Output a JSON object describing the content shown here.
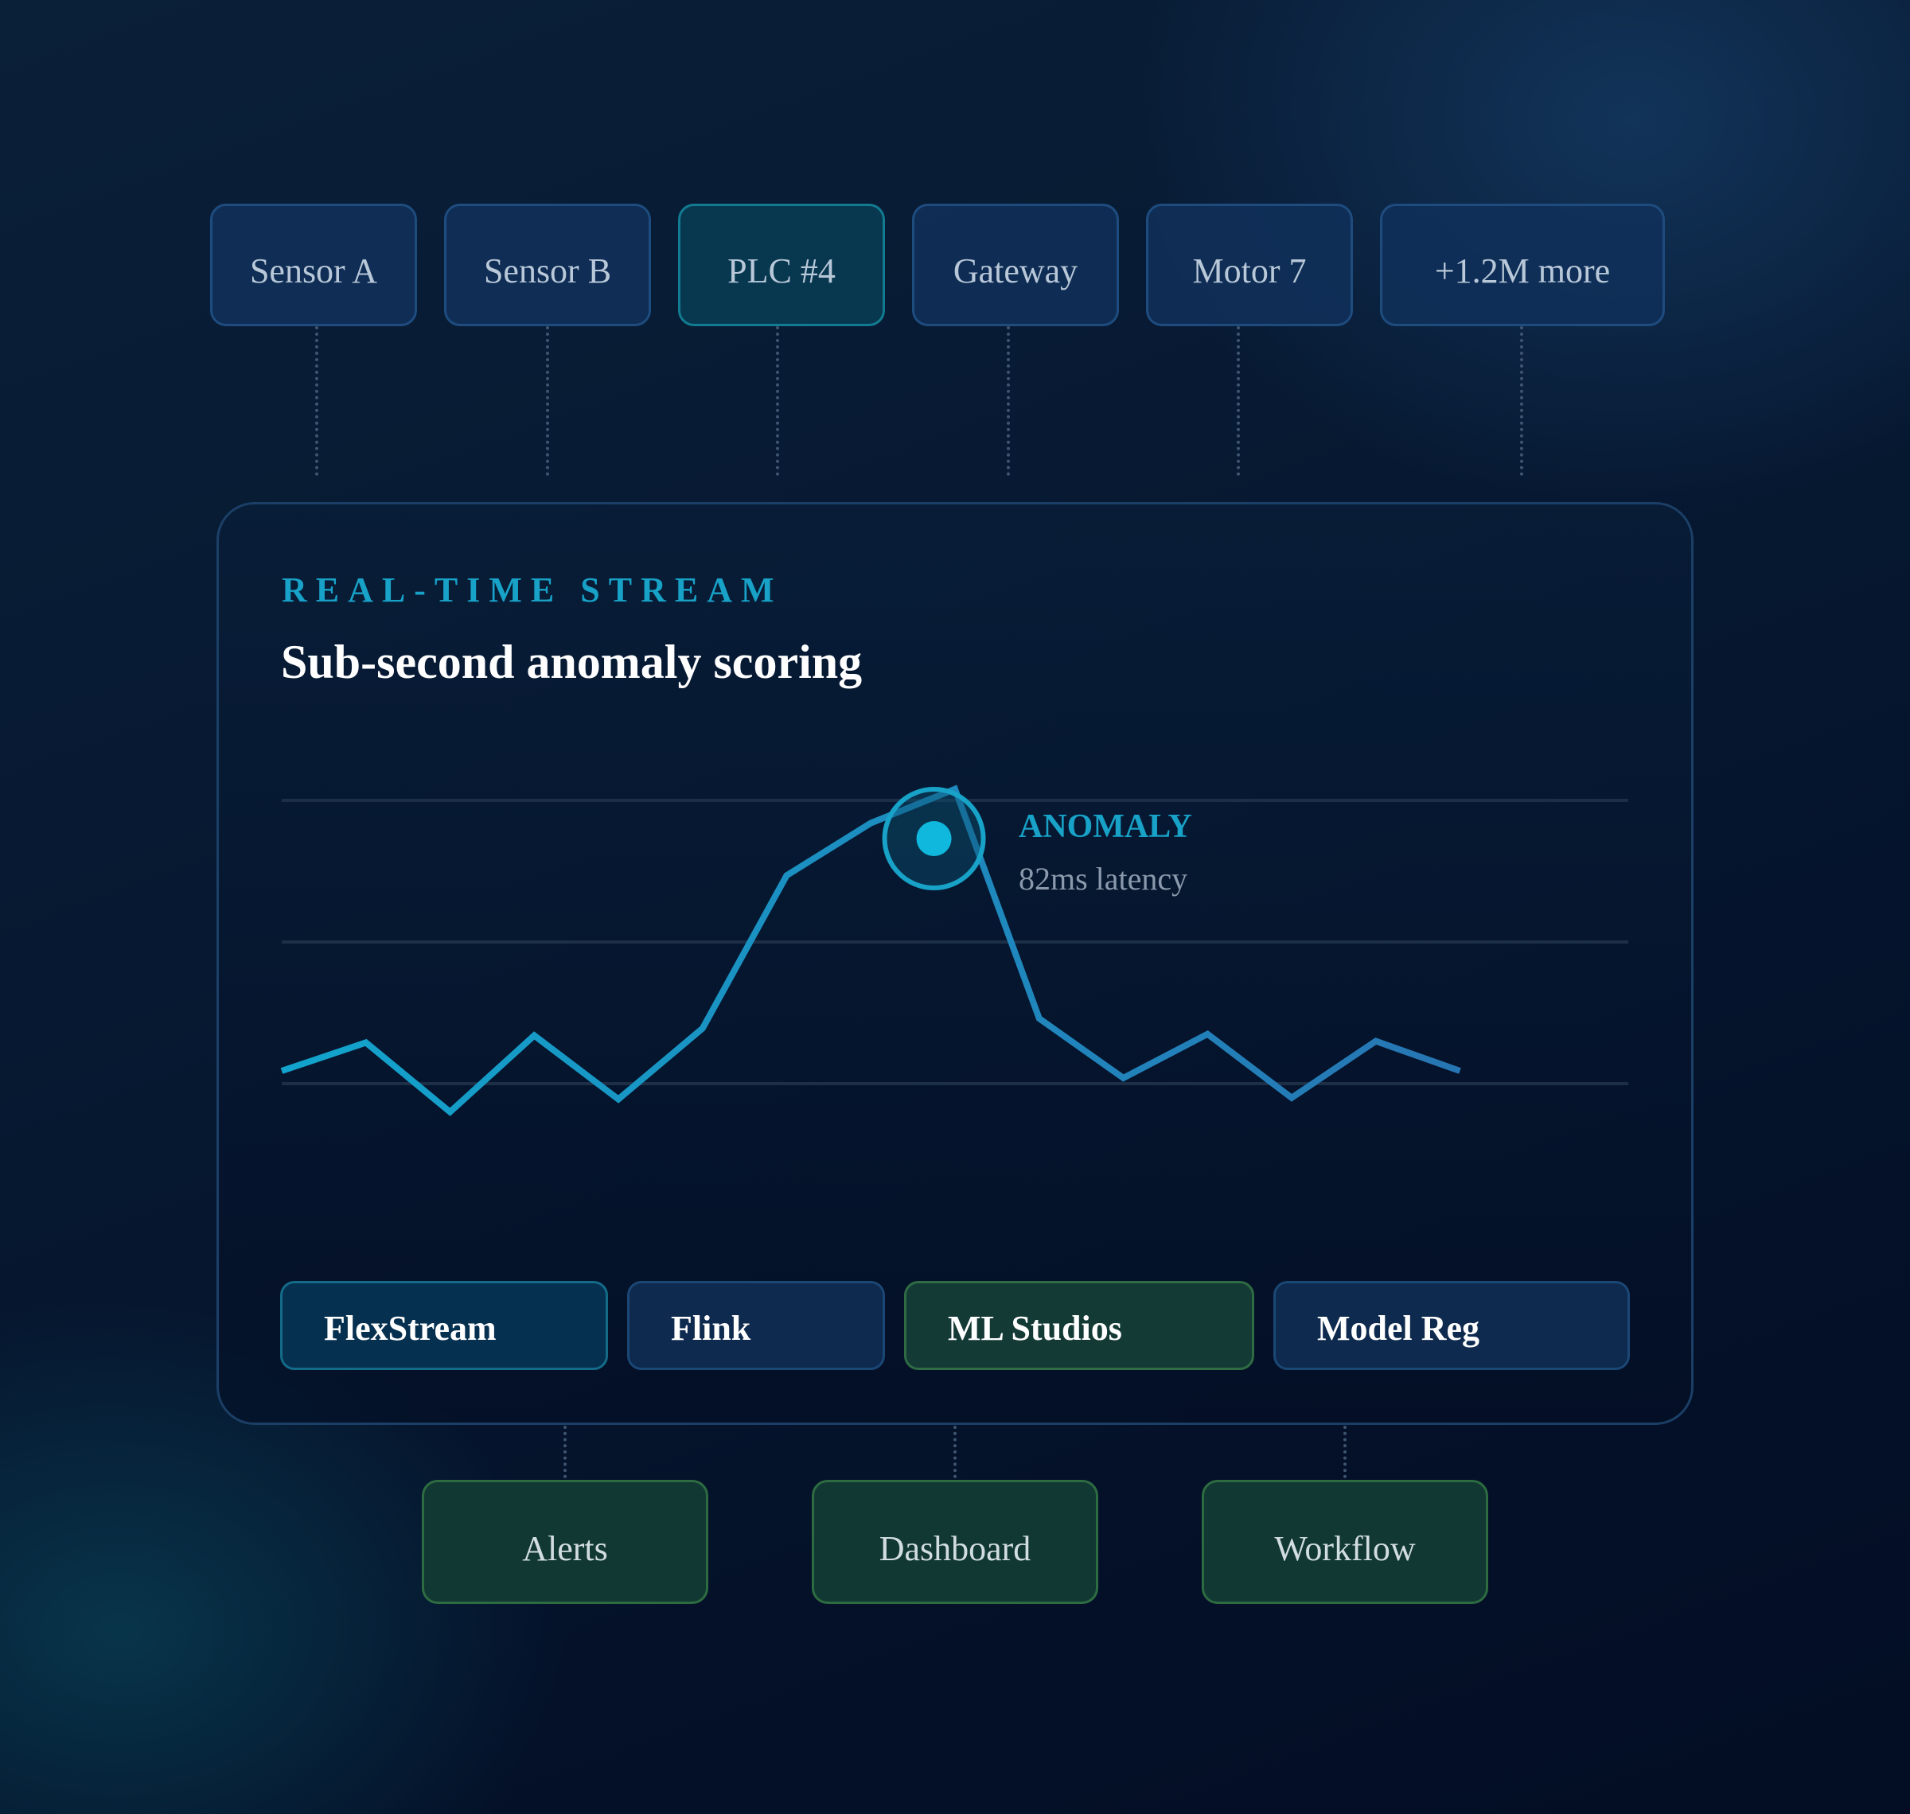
{
  "sources": [
    "Sensor A",
    "Sensor B",
    "PLC #4",
    "Gateway",
    "Motor 7",
    "+1.2M more"
  ],
  "panel": {
    "eyebrow": "REAL-TIME STREAM",
    "headline": "Sub-second anomaly scoring"
  },
  "chart_data": {
    "type": "line",
    "x": [
      0,
      1,
      2,
      3,
      4,
      5,
      6,
      7,
      8,
      9,
      10,
      11,
      12,
      13,
      14,
      15,
      16
    ],
    "series": [
      {
        "values": [
          0.09,
          0.29,
          -0.2,
          0.34,
          -0.11,
          0.39,
          1.47,
          1.84,
          2.08,
          0.46,
          0.04,
          0.35,
          -0.1,
          0.3,
          0.09,
          null,
          null
        ]
      }
    ],
    "annotation": {
      "label": "ANOMALY",
      "detail": "82ms latency",
      "x": 7.75,
      "y": 1.73
    },
    "grid": true,
    "gridlines": 3
  },
  "tools": [
    "FlexStream",
    "Flink",
    "ML Studios",
    "Model Reg"
  ],
  "outputs": [
    "Alerts",
    "Dashboard",
    "Workflow"
  ],
  "colors": {
    "accent": "#18a2c8",
    "line_start": "#12a4cc",
    "line_end": "#2a6fb0",
    "output_border": "#2d6b41"
  }
}
